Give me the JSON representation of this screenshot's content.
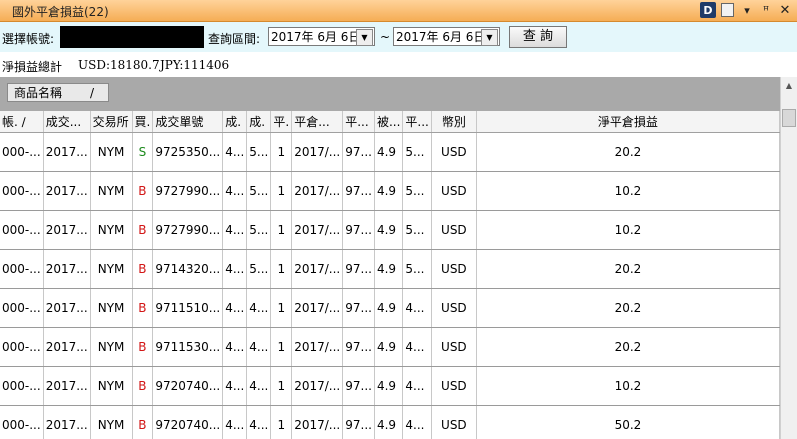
{
  "window": {
    "title": "國外平倉損益(22)",
    "icons": [
      "d-app-icon",
      "page-icon",
      "chevron-down-icon",
      "pin-icon",
      "close-icon"
    ],
    "d_label": "D"
  },
  "filter": {
    "account_label": "選擇帳號:",
    "range_label": "查詢區間:",
    "date_from": "2017年 6月 6日",
    "tilde": "~",
    "date_to": "2017年 6月 6日",
    "query_label": "查 詢"
  },
  "summary": {
    "total_label": "淨損益總計",
    "usd": "USD:18180.7",
    "jpy": "JPY:111406"
  },
  "group": {
    "label": "商品名稱",
    "sort_glyph": "/"
  },
  "columns": [
    "帳. ∕",
    "成交...",
    "交易所",
    "買.",
    "成交單號",
    "成.",
    "成.",
    "平.",
    "平倉...",
    "平...",
    "被...",
    "平...",
    "幣別",
    "淨平倉損益"
  ],
  "rows": [
    [
      "000-...",
      "2017...",
      "NYM",
      "S",
      "9725350...",
      "4...",
      "5...",
      "1",
      "2017/...",
      "97...",
      "4.9",
      "5...",
      "USD",
      "20.2"
    ],
    [
      "000-...",
      "2017...",
      "NYM",
      "B",
      "9727990...",
      "4...",
      "5...",
      "1",
      "2017/...",
      "97...",
      "4.9",
      "5...",
      "USD",
      "10.2"
    ],
    [
      "000-...",
      "2017...",
      "NYM",
      "B",
      "9727990...",
      "4...",
      "5...",
      "1",
      "2017/...",
      "97...",
      "4.9",
      "5...",
      "USD",
      "10.2"
    ],
    [
      "000-...",
      "2017...",
      "NYM",
      "B",
      "9714320...",
      "4...",
      "5...",
      "1",
      "2017/...",
      "97...",
      "4.9",
      "5...",
      "USD",
      "20.2"
    ],
    [
      "000-...",
      "2017...",
      "NYM",
      "B",
      "9711510...",
      "4...",
      "4...",
      "1",
      "2017/...",
      "97...",
      "4.9",
      "4...",
      "USD",
      "20.2"
    ],
    [
      "000-...",
      "2017...",
      "NYM",
      "B",
      "9711530...",
      "4...",
      "4...",
      "1",
      "2017/...",
      "97...",
      "4.9",
      "4...",
      "USD",
      "20.2"
    ],
    [
      "000-...",
      "2017...",
      "NYM",
      "B",
      "9720740...",
      "4...",
      "4...",
      "1",
      "2017/...",
      "97...",
      "4.9",
      "4...",
      "USD",
      "10.2"
    ],
    [
      "000-...",
      "2017...",
      "NYM",
      "B",
      "9720740...",
      "4...",
      "4...",
      "1",
      "2017/...",
      "97...",
      "4.9",
      "4...",
      "USD",
      "50.2"
    ]
  ],
  "colors": {
    "title_bg": "#f5ad55",
    "filter_bg": "#e4f7fb",
    "buy": "#d21616",
    "sell": "#1d8a1d"
  }
}
